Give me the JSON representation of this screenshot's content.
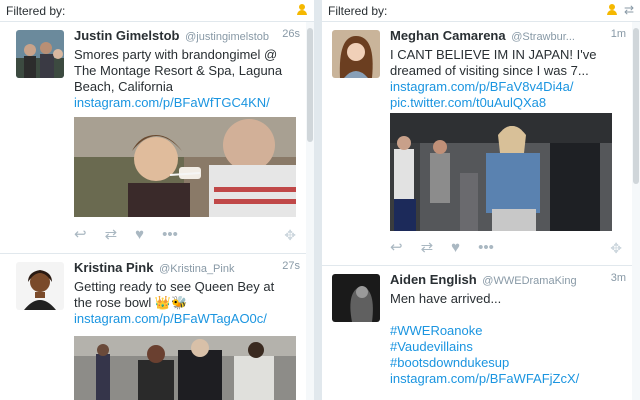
{
  "left_column": {
    "filter_label": "Filtered by:",
    "tweets": [
      {
        "name": "Justin Gimelstob",
        "handle": "@justingimelstob",
        "time": "26s",
        "text": "Smores party with brandongimel @ The Montage Resort & Spa, Laguna Beach, California",
        "links": [
          "instagram.com/p/BFaWfTGC4KN/"
        ]
      },
      {
        "name": "Kristina Pink",
        "handle": "@Kristina_Pink",
        "time": "27s",
        "text": "Getting ready to see Queen Bey at the rose bowl 👑🐝",
        "links": [
          "instagram.com/p/BFaWTagAO0c/"
        ]
      }
    ]
  },
  "right_column": {
    "filter_label": "Filtered by:",
    "tweets": [
      {
        "name": "Meghan Camarena",
        "handle": "@Strawbur...",
        "time": "1m",
        "text": "I CANT BELIEVE IM IN JAPAN! I've dreamed of visiting since I was 7...",
        "links": [
          "instagram.com/p/BFaV8v4Di4a/",
          "pic.twitter.com/t0uAulQXa8"
        ]
      },
      {
        "name": "Aiden English",
        "handle": "@WWEDramaKing",
        "time": "3m",
        "text": "Men have arrived...",
        "links": [
          "#WWERoanoke",
          "#Vaudevillains",
          "#bootsdowndukesup",
          "instagram.com/p/BFaWFAFjZcX/"
        ]
      }
    ]
  },
  "icons": {
    "reply": "reply-icon",
    "retweet": "retweet-icon",
    "like": "heart-icon",
    "more": "more-icon",
    "drag": "drag-icon",
    "filter_user": "user-filter-icon"
  },
  "colors": {
    "link": "#1b95e0",
    "muted": "#8899a6",
    "action": "#aab8c2",
    "filter_icon": "#f5b800"
  }
}
